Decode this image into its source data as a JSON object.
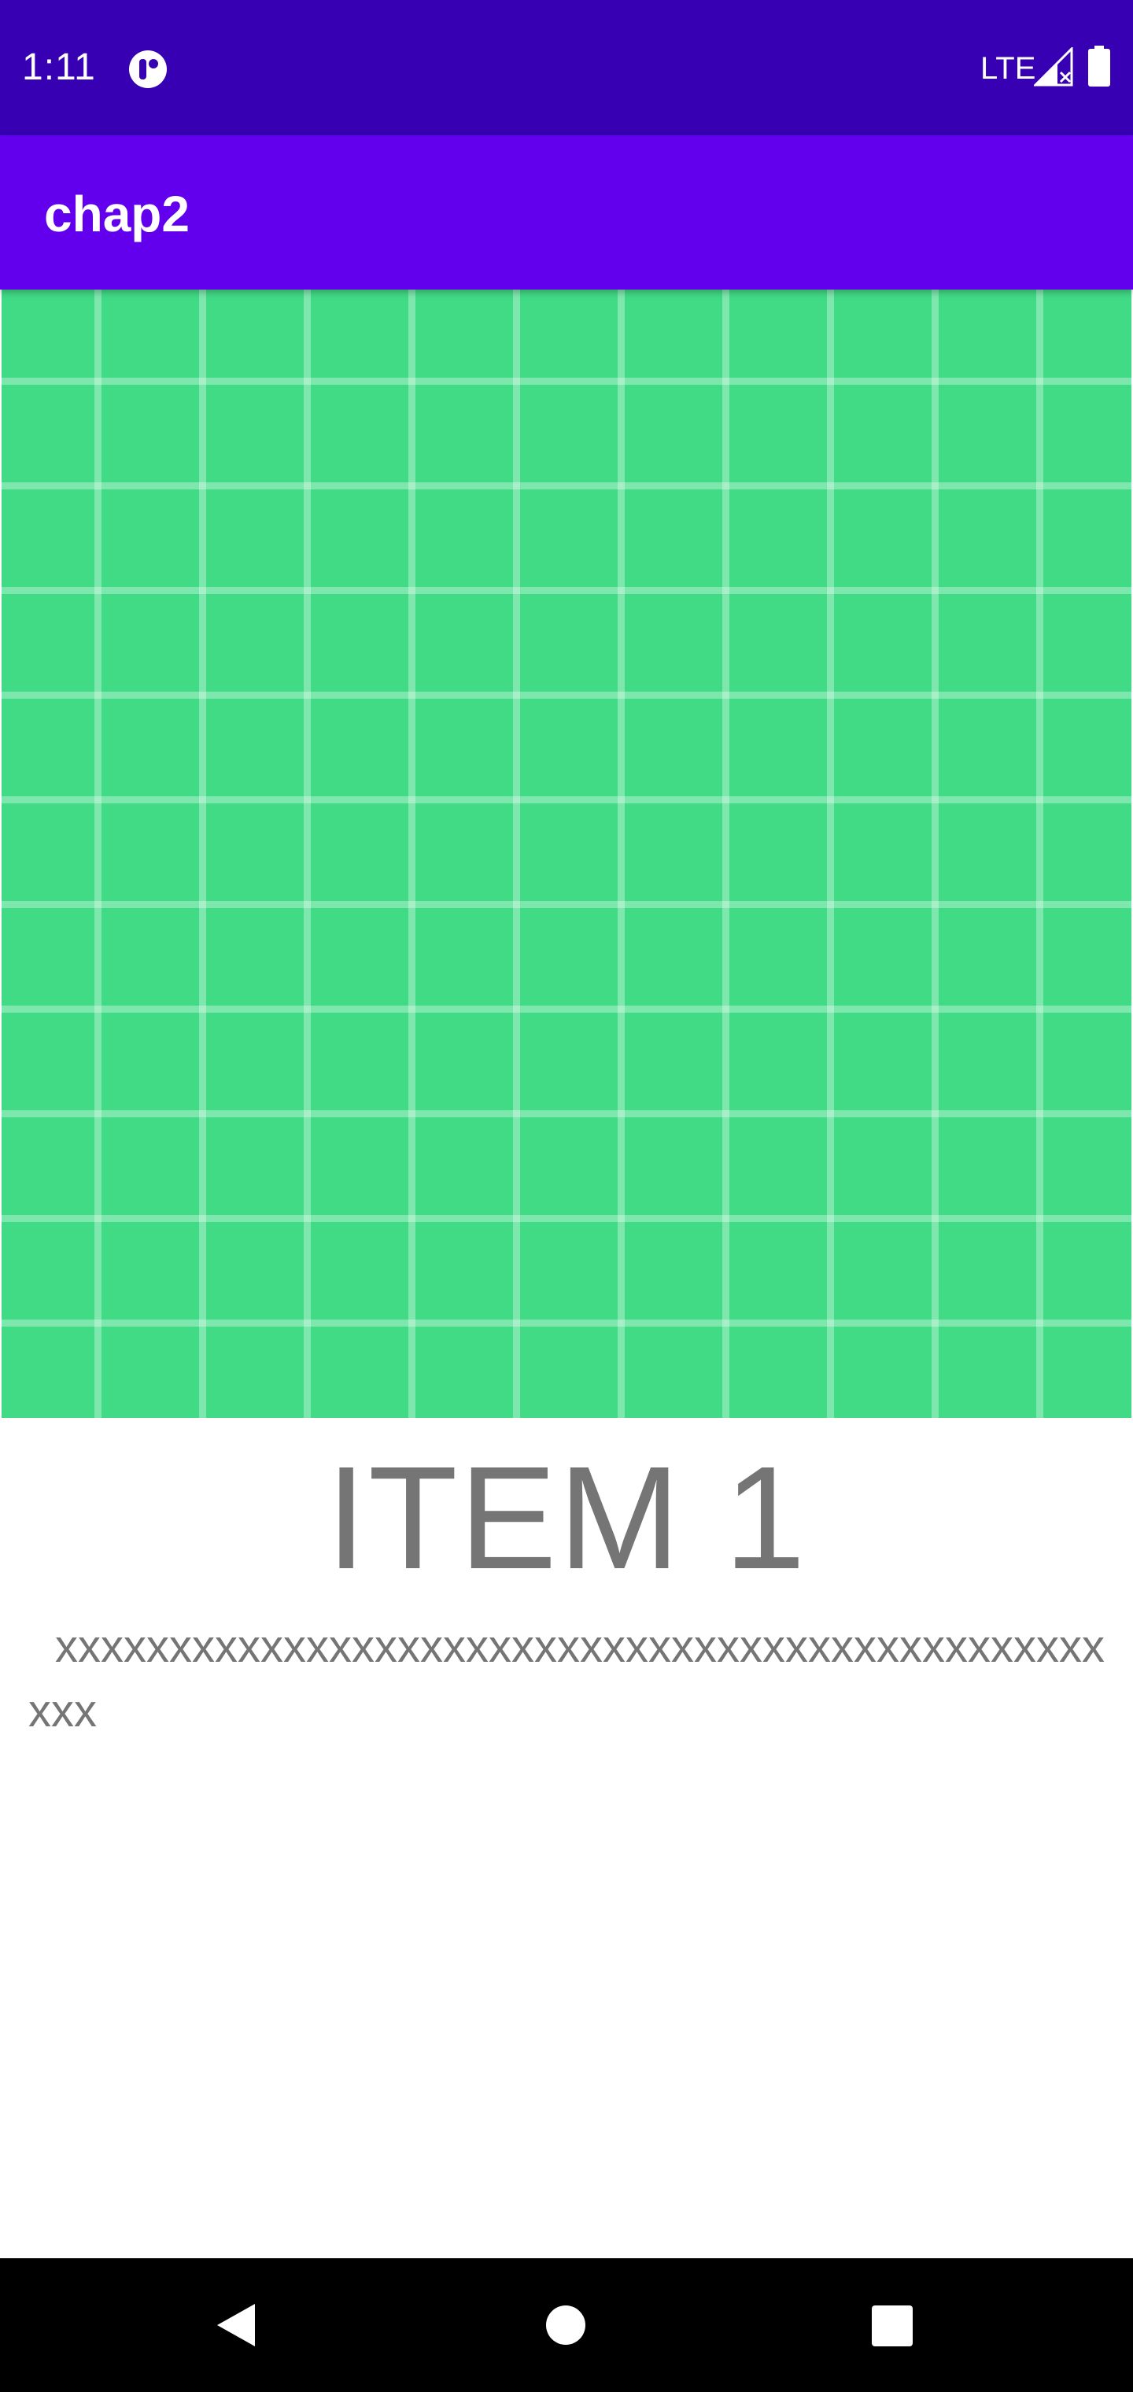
{
  "status_bar": {
    "time": "1:11",
    "network": "LTE",
    "icons": [
      "app-notification-icon",
      "signal-icon",
      "battery-icon"
    ],
    "background": "#3700B3"
  },
  "app_bar": {
    "title": "chap2",
    "background": "#6200EE"
  },
  "content": {
    "image_icon": "grid-placeholder-image",
    "image_color": "#41DB86",
    "item_title": "ITEM 1",
    "item_description": "xxxxxxxxxxxxxxxxxxxxxxxxxxxxxxxxxxxxxxxxxxxxxxxxx",
    "text_color": "#757575"
  },
  "nav_bar": {
    "icons": [
      "back-icon",
      "home-icon",
      "recents-icon"
    ]
  }
}
